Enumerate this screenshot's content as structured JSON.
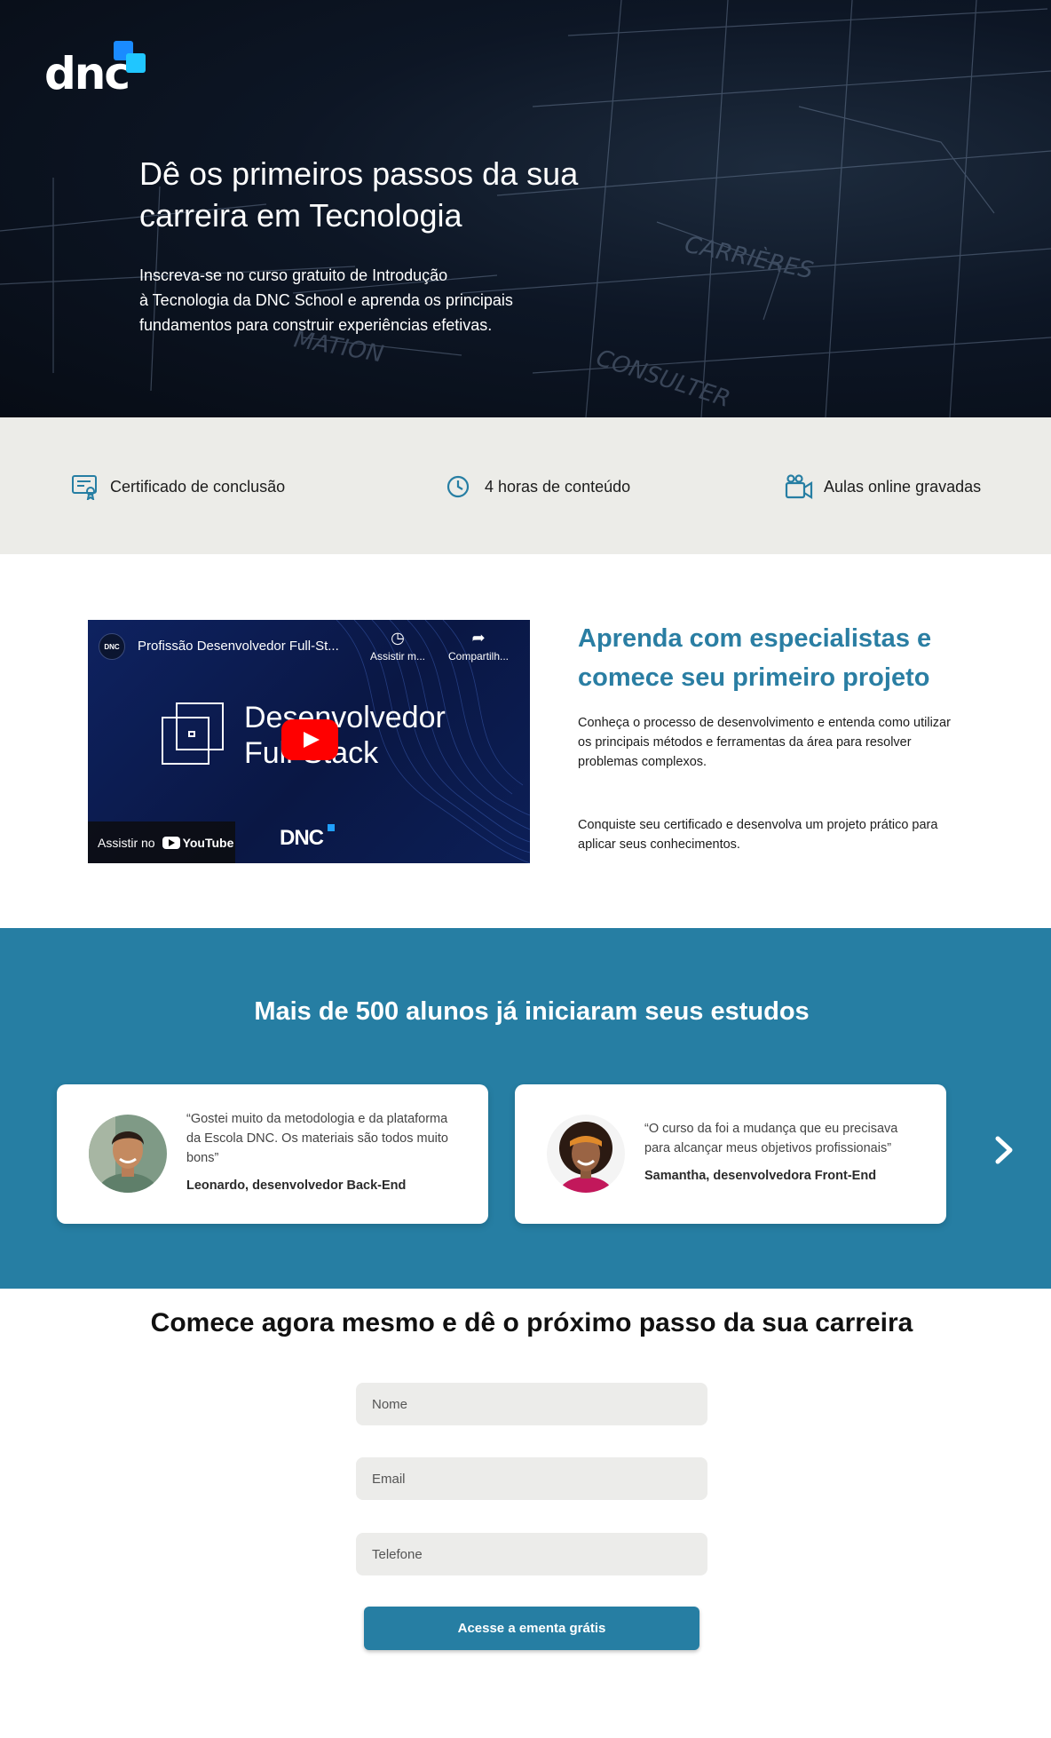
{
  "brand": {
    "logo_text": "dnc",
    "logo_colors": [
      "#1a8bff",
      "#20c6ff"
    ]
  },
  "hero": {
    "title": "Dê os primeiros passos da sua carreira em Tecnologia",
    "subtitle_lines": [
      "Inscreva-se no curso gratuito de Introdução",
      "à Tecnologia da DNC School e aprenda os principais",
      "fundamentos para construir experiências efetivas."
    ]
  },
  "features": [
    {
      "icon": "certificate-icon",
      "label": "Certificado de conclusão"
    },
    {
      "icon": "clock-icon",
      "label": "4 horas de conteúdo"
    },
    {
      "icon": "video-camera-icon",
      "label": "Aulas online gravadas"
    }
  ],
  "video": {
    "channel_badge": "DNC",
    "title": "Profissão Desenvolvedor Full-St...",
    "watch_later": "Assistir m...",
    "share": "Compartilh...",
    "thumbnail_line1": "Desenvolvedor",
    "thumbnail_line2": "Full-Stack",
    "watch_on": "Assistir no",
    "youtube": "YouTube",
    "brand": "DNC"
  },
  "learn": {
    "title": "Aprenda com especialistas e comece seu primeiro projeto",
    "p1_lines": [
      "Conheça o processo de desenvolvimento e entenda como utilizar",
      "os principais métodos e ferramentas da área para resolver problemas complexos."
    ],
    "p2": "Conquiste seu certificado e desenvolva um projeto prático para aplicar seus conhecimentos."
  },
  "testimonials": {
    "title": "Mais de 500 alunos já iniciaram seus estudos",
    "items": [
      {
        "quote": "“Gostei muito da metodologia e da plataforma da Escola DNC. Os materiais são todos muito bons”",
        "author": "Leonardo, desenvolvedor Back-End"
      },
      {
        "quote": "“O curso da foi a mudança que eu precisava para alcançar meus objetivos profissionais”",
        "author": "Samantha, desenvolvedora Front-End"
      }
    ]
  },
  "cta": {
    "title": "Comece agora mesmo e dê o próximo passo da sua carreira",
    "name_placeholder": "Nome",
    "email_placeholder": "Email",
    "phone_placeholder": "Telefone",
    "submit_label": "Acesse a ementa grátis"
  },
  "colors": {
    "accent": "#267ea3",
    "hero_bg": "#0d1625",
    "features_bg": "#ecece8",
    "input_bg": "#ececea"
  }
}
